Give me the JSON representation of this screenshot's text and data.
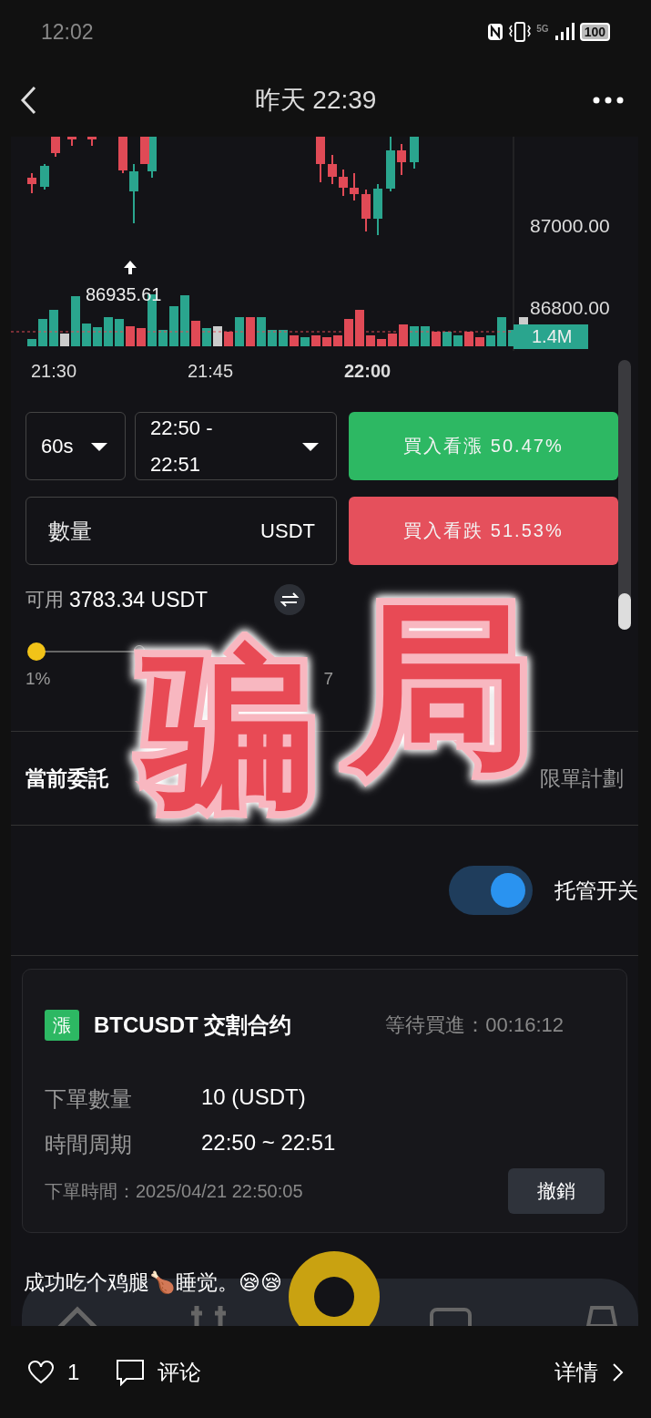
{
  "status_bar": {
    "time": "12:02",
    "network": "5G",
    "battery": "100"
  },
  "header": {
    "title": "昨天 22:39"
  },
  "chart": {
    "price_labels": [
      "87000.00",
      "86800.00"
    ],
    "low_marker": "86935.61",
    "volume_badge": "1.4M",
    "time_labels": [
      {
        "label": "21:30",
        "emphasized": false
      },
      {
        "label": "21:45",
        "emphasized": false
      },
      {
        "label": "22:00",
        "emphasized": true
      }
    ]
  },
  "order_form": {
    "interval": "60s",
    "period": "22:50 - 22:51",
    "buy_up": "買入看漲 50.47%",
    "buy_down": "買入看跌 51.53%",
    "amount_placeholder": "數量",
    "amount_unit": "USDT",
    "available_label": "可用",
    "available_value": "3783.34 USDT",
    "slider": {
      "level": 0,
      "labels": [
        "1%",
        "7"
      ]
    }
  },
  "stamp": "骗局",
  "tabs": [
    {
      "label": "當前委託",
      "selected": true
    },
    {
      "label": "限單計劃",
      "selected": false
    }
  ],
  "auto_toggle": {
    "label": "托管开关",
    "on": true
  },
  "order_card": {
    "side_badge": "漲",
    "symbol": "BTCUSDT 交割合约",
    "status": "等待買進：00:16:12",
    "rows": [
      {
        "label": "下單數量",
        "value": "10 (USDT)"
      },
      {
        "label": "時間周期",
        "value": "22:50 ~ 22:51"
      }
    ],
    "placed_at": "下單時間：2025/04/21 22:50:05",
    "cancel": "撤銷"
  },
  "caption": "成功吃个鸡腿🍗睡觉。😪😪",
  "footer": {
    "likes": "1",
    "comment": "评论",
    "details": "详情"
  }
}
